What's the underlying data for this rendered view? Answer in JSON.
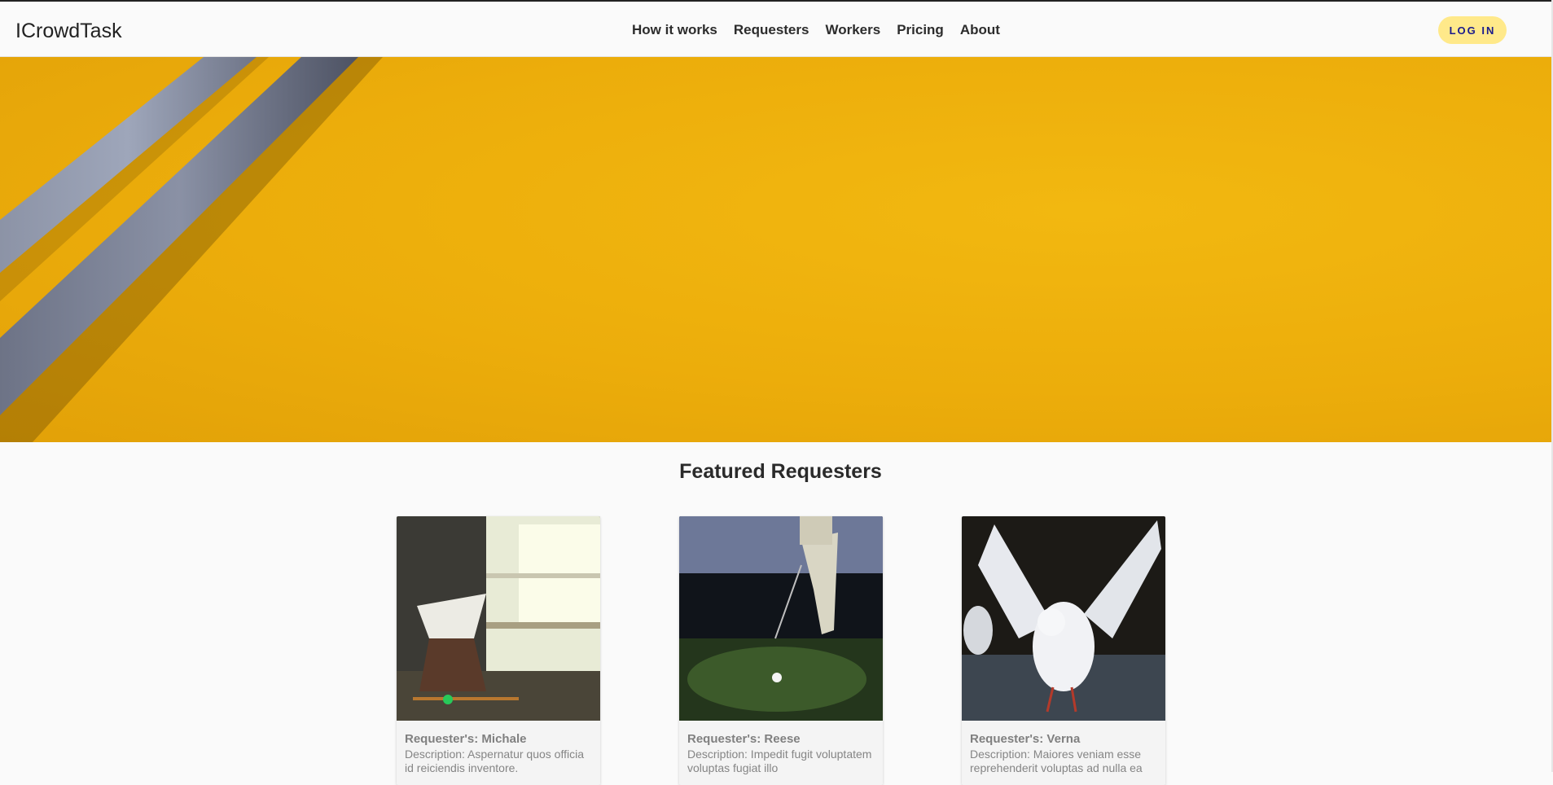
{
  "brand": "ICrowdTask",
  "nav": {
    "items": [
      "How it works",
      "Requesters",
      "Workers",
      "Pricing",
      "About"
    ]
  },
  "header": {
    "login_label": "LOG IN"
  },
  "featured": {
    "title": "Featured Requesters",
    "cards": [
      {
        "name": "Requester's: Michale",
        "description": "Description: Aspernatur quos officia id reiciendis inventore."
      },
      {
        "name": "Requester's: Reese",
        "description": "Description: Impedit fugit voluptatem voluptas fugiat illo"
      },
      {
        "name": "Requester's: Verna",
        "description": "Description: Maiores veniam esse reprehenderit voluptas ad nulla ea"
      }
    ]
  },
  "colors": {
    "hero": "#ecad0b",
    "login_bg": "#ffe98a",
    "login_text": "#1a1a8c"
  }
}
